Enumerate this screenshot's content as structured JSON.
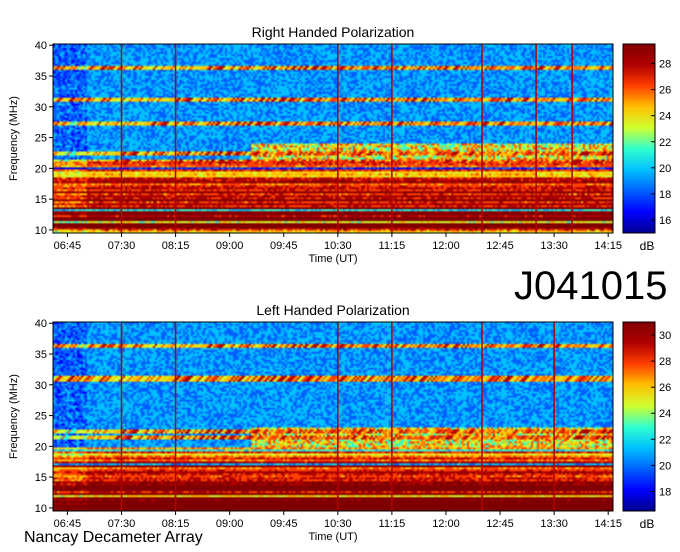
{
  "figure": {
    "observation_id": "J041015",
    "site": "Nancay Decameter Array",
    "spectrogram_colors": [
      "#00008f",
      "#0000ff",
      "#0060ff",
      "#00c0ff",
      "#30ffcf",
      "#cfff30",
      "#ffc000",
      "#ff4000",
      "#b00000",
      "#800000"
    ]
  },
  "chart_data": [
    {
      "type": "heatmap",
      "title": "Right Handed Polarization",
      "xlabel": "Time (UT)",
      "ylabel": "Frequency (MHz)",
      "x_ticks": [
        "06:45",
        "07:30",
        "08:15",
        "09:00",
        "09:45",
        "10:30",
        "11:15",
        "12:00",
        "12:45",
        "13:30",
        "14:15"
      ],
      "xlim": [
        "06:33",
        "14:19"
      ],
      "y_ticks": [
        10,
        15,
        20,
        25,
        30,
        35,
        40
      ],
      "ylim": [
        9.5,
        40.2
      ],
      "colorbar": {
        "label": "dB",
        "ticks": [
          16,
          18,
          20,
          22,
          24,
          26,
          28
        ],
        "range": [
          15,
          29.5
        ]
      },
      "strong_emission_below_mhz": 21,
      "vertical_marker_times": [
        "07:30",
        "08:15",
        "10:30",
        "11:15",
        "12:30",
        "13:15",
        "13:45"
      ],
      "interference_bands_mhz": [
        36.2,
        31.2,
        27.2,
        22.5,
        21.2
      ]
    },
    {
      "type": "heatmap",
      "title": "Left Handed Polarization",
      "xlabel": "Time (UT)",
      "ylabel": "Frequency (MHz)",
      "x_ticks": [
        "06:45",
        "07:30",
        "08:15",
        "09:00",
        "09:45",
        "10:30",
        "11:15",
        "12:00",
        "12:45",
        "13:30",
        "14:15"
      ],
      "xlim": [
        "06:33",
        "14:19"
      ],
      "y_ticks": [
        10,
        15,
        20,
        25,
        30,
        35,
        40
      ],
      "ylim": [
        9.5,
        40.2
      ],
      "colorbar": {
        "label": "dB",
        "ticks": [
          18,
          20,
          22,
          24,
          26,
          28,
          30
        ],
        "range": [
          16.5,
          31
        ]
      },
      "strong_emission_below_mhz": 20,
      "vertical_marker_times": [
        "07:30",
        "08:15",
        "10:30",
        "11:15",
        "12:30",
        "13:30"
      ],
      "interference_bands_mhz": [
        36.3,
        31.0,
        22.5,
        21.5
      ]
    }
  ]
}
